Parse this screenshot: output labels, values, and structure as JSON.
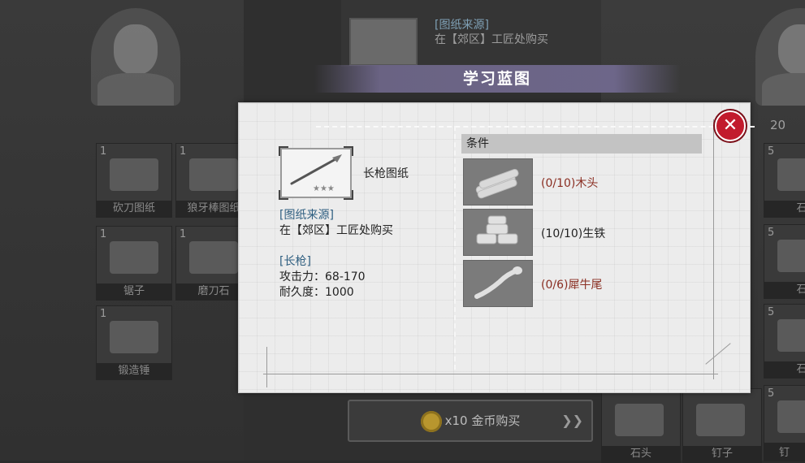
{
  "background": {
    "top_note": {
      "source_heading": "[图纸来源]",
      "source_text": "在【郊区】工匠处购买"
    },
    "left_slots": [
      {
        "count": "1",
        "caption": "砍刀图纸"
      },
      {
        "count": "1",
        "caption": "狼牙棒图纸"
      },
      {
        "count": "1",
        "caption": "锯子"
      },
      {
        "count": "1",
        "caption": "磨刀石"
      },
      {
        "count": "1",
        "caption": "锻造锤"
      }
    ],
    "right_count": "20",
    "right_slots": [
      {
        "count": "5",
        "caption": "石"
      },
      {
        "count": "5",
        "caption": "石"
      },
      {
        "count": "5",
        "caption": "石"
      },
      {
        "count": "5",
        "caption": "石"
      }
    ],
    "bottom_items": [
      "石头",
      "钉子",
      "钉"
    ],
    "buy_button": {
      "label": "x10 金币购买",
      "arrows": "❯❯"
    }
  },
  "dialog": {
    "title": "学习蓝图",
    "close_icon": "✕",
    "blueprint_name": "长枪图纸",
    "source_heading": "[图纸来源]",
    "source_text": "在【郊区】工匠处购买",
    "weapon_heading": "[长枪]",
    "attack": "攻击力：68-170",
    "durability": "耐久度：1000",
    "conditions_label": "条件",
    "materials": [
      {
        "icon": "wood-logs-icon",
        "progress": "(0/10)",
        "name": "木头",
        "met": false
      },
      {
        "icon": "pig-iron-ingots-icon",
        "progress": "(10/10)",
        "name": "生铁",
        "met": true
      },
      {
        "icon": "rhino-tail-icon",
        "progress": "(0/6)",
        "name": "犀牛尾",
        "met": false
      }
    ]
  },
  "colors": {
    "banner": "#6a6383",
    "close_button": "#c21b2d",
    "insufficient_text": "#8a2e22",
    "heading_blue": "#2e5e80"
  }
}
